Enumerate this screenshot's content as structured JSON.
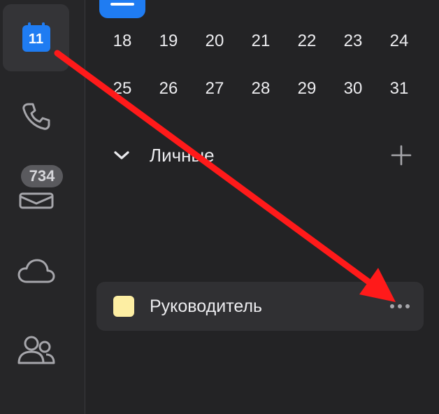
{
  "sidebar": {
    "calendar_day": "11",
    "mail_badge": "734",
    "items": [
      {
        "icon": "calendar-icon",
        "active": true
      },
      {
        "icon": "phone-icon"
      },
      {
        "icon": "mail-icon"
      },
      {
        "icon": "cloud-icon"
      },
      {
        "icon": "contacts-icon"
      }
    ]
  },
  "mini_calendar": {
    "weeks": [
      [
        "18",
        "19",
        "20",
        "21",
        "22",
        "23",
        "24"
      ],
      [
        "25",
        "26",
        "27",
        "28",
        "29",
        "30",
        "31"
      ]
    ]
  },
  "section": {
    "title": "Личные"
  },
  "calendar_item": {
    "label": "Руководитель",
    "color": "#fdeea3"
  },
  "colors": {
    "accent": "#1f7cf2",
    "annotation_arrow": "#ff1a1a"
  }
}
